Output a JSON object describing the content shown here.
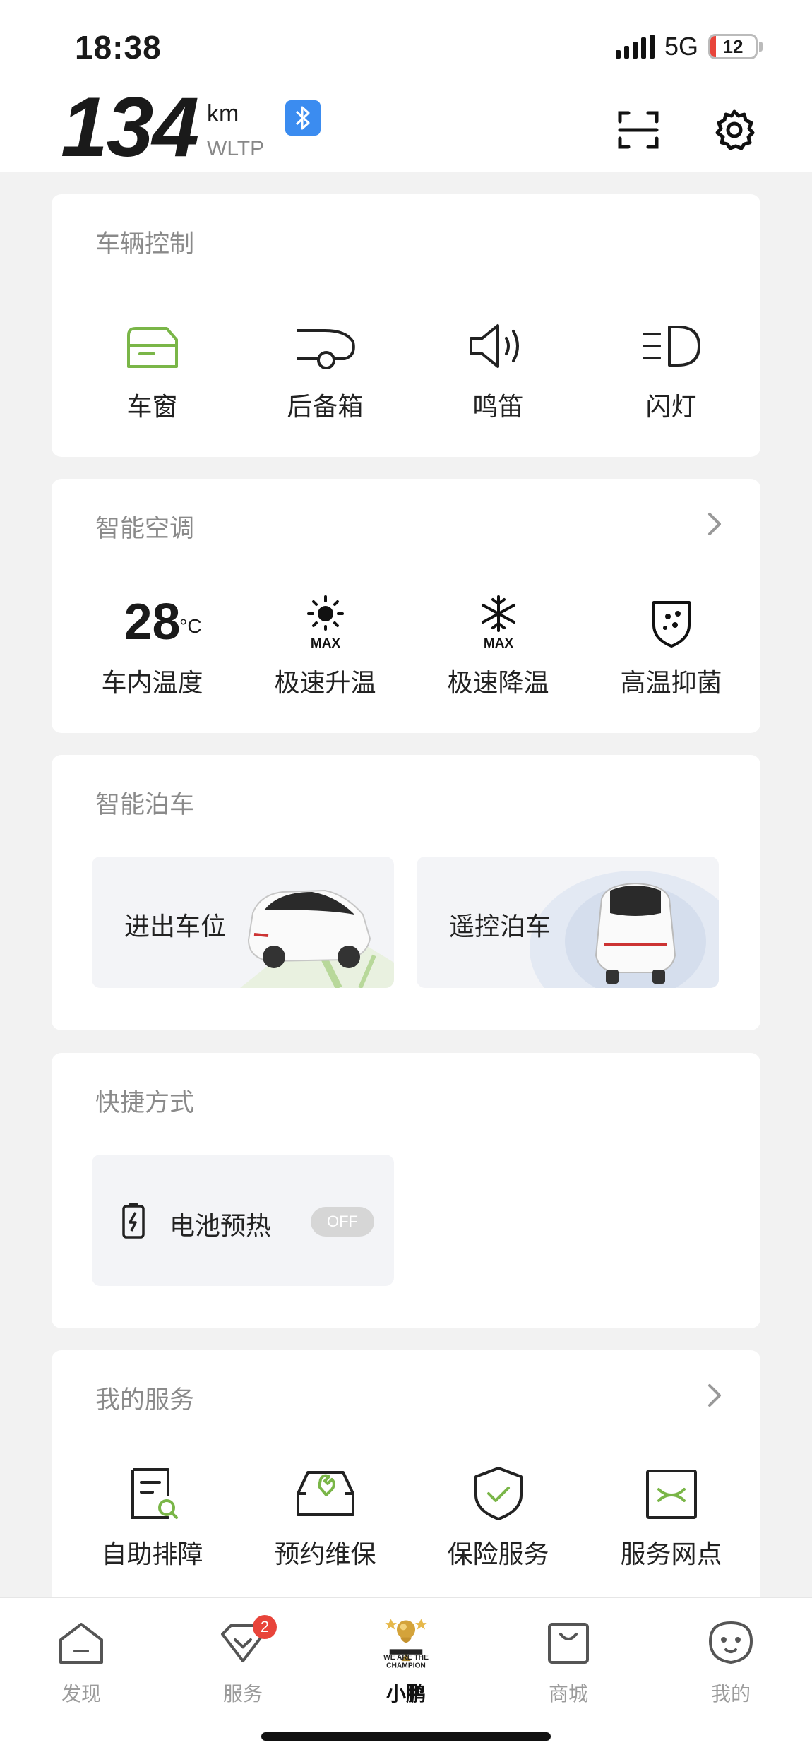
{
  "status": {
    "time": "18:38",
    "network": "5G",
    "battery": "12",
    "battery_level": 0.12
  },
  "header": {
    "range_value": "134",
    "range_unit": "km",
    "range_standard": "WLTP"
  },
  "vehicle_control": {
    "title": "车辆控制",
    "items": [
      {
        "label": "车窗",
        "icon": "window-icon"
      },
      {
        "label": "后备箱",
        "icon": "trunk-icon"
      },
      {
        "label": "鸣笛",
        "icon": "horn-icon"
      },
      {
        "label": "闪灯",
        "icon": "headlight-icon"
      }
    ]
  },
  "climate": {
    "title": "智能空调",
    "temperature": "28",
    "temperature_unit": "°C",
    "max_text": "MAX",
    "items": [
      {
        "label": "车内温度"
      },
      {
        "label": "极速升温",
        "icon": "sun-max-icon"
      },
      {
        "label": "极速降温",
        "icon": "snowflake-max-icon"
      },
      {
        "label": "高温抑菌",
        "icon": "shield-dots-icon"
      }
    ]
  },
  "parking": {
    "title": "智能泊车",
    "tiles": [
      {
        "label": "进出车位"
      },
      {
        "label": "遥控泊车"
      }
    ]
  },
  "shortcuts": {
    "title": "快捷方式",
    "items": [
      {
        "label": "电池预热",
        "toggle": "OFF",
        "icon": "battery-charge-icon"
      }
    ]
  },
  "services": {
    "title": "我的服务",
    "items": [
      {
        "label": "自助排障",
        "icon": "doc-search-icon"
      },
      {
        "label": "预约维保",
        "icon": "car-wrench-icon"
      },
      {
        "label": "保险服务",
        "icon": "shield-check-icon"
      },
      {
        "label": "服务网点",
        "icon": "map-icon"
      }
    ]
  },
  "tabbar": {
    "items": [
      {
        "label": "发现",
        "icon": "home-icon"
      },
      {
        "label": "服务",
        "icon": "heart-check-icon",
        "badge": "2"
      },
      {
        "label": "小鹏",
        "icon": "trophy-icon",
        "badge_text": "WE ARE THE CHAMPION"
      },
      {
        "label": "商城",
        "icon": "bag-icon"
      },
      {
        "label": "我的",
        "icon": "face-icon"
      }
    ]
  },
  "colors": {
    "accent_green": "#7ab648",
    "bluetooth_blue": "#3b8cf0",
    "badge_red": "#e8443a"
  }
}
